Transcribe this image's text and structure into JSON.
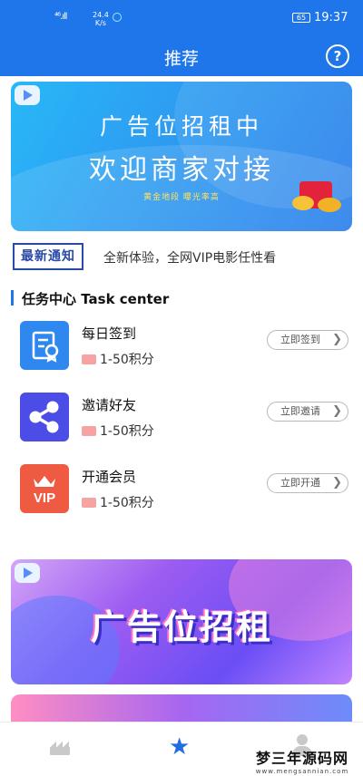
{
  "status_bar": {
    "signal": "⁴⁶.ıll",
    "speed_value": "24.4",
    "speed_unit": "K/s",
    "battery": "65",
    "time": "19:37"
  },
  "header": {
    "title": "推荐",
    "help_label": "?"
  },
  "banner_top": {
    "line1": "广告位招租中",
    "line2": "欢迎商家对接",
    "line3": "黄金地段 曝光率高"
  },
  "notice": {
    "tag": "最新通知",
    "text": "全新体验，全网VIP电影任性看"
  },
  "task_center": {
    "title": "任务中心 Task center",
    "tasks": [
      {
        "name": "每日签到",
        "points": "1-50积分",
        "button": "立即签到",
        "icon": "certificate-icon"
      },
      {
        "name": "邀请好友",
        "points": "1-50积分",
        "button": "立即邀请",
        "icon": "share-icon"
      },
      {
        "name": "开通会员",
        "points": "1-50积分",
        "button": "立即开通",
        "icon": "vip-crown-icon"
      }
    ]
  },
  "banner_mid": {
    "text": "广告位招租"
  },
  "bottom_nav": {
    "items": [
      {
        "icon": "crown-icon",
        "active": false
      },
      {
        "icon": "star-icon",
        "active": true
      },
      {
        "icon": "user-icon",
        "active": false
      }
    ]
  },
  "watermark": {
    "cn": "梦三年源码网",
    "url": "www.mengsannian.com"
  },
  "colors": {
    "primary": "#1f76ea",
    "notice_border": "#2a4aa8",
    "task_icon_1": "#2f88ee",
    "task_icon_2": "#4b4de6",
    "task_icon_3": "#ef5a42"
  }
}
